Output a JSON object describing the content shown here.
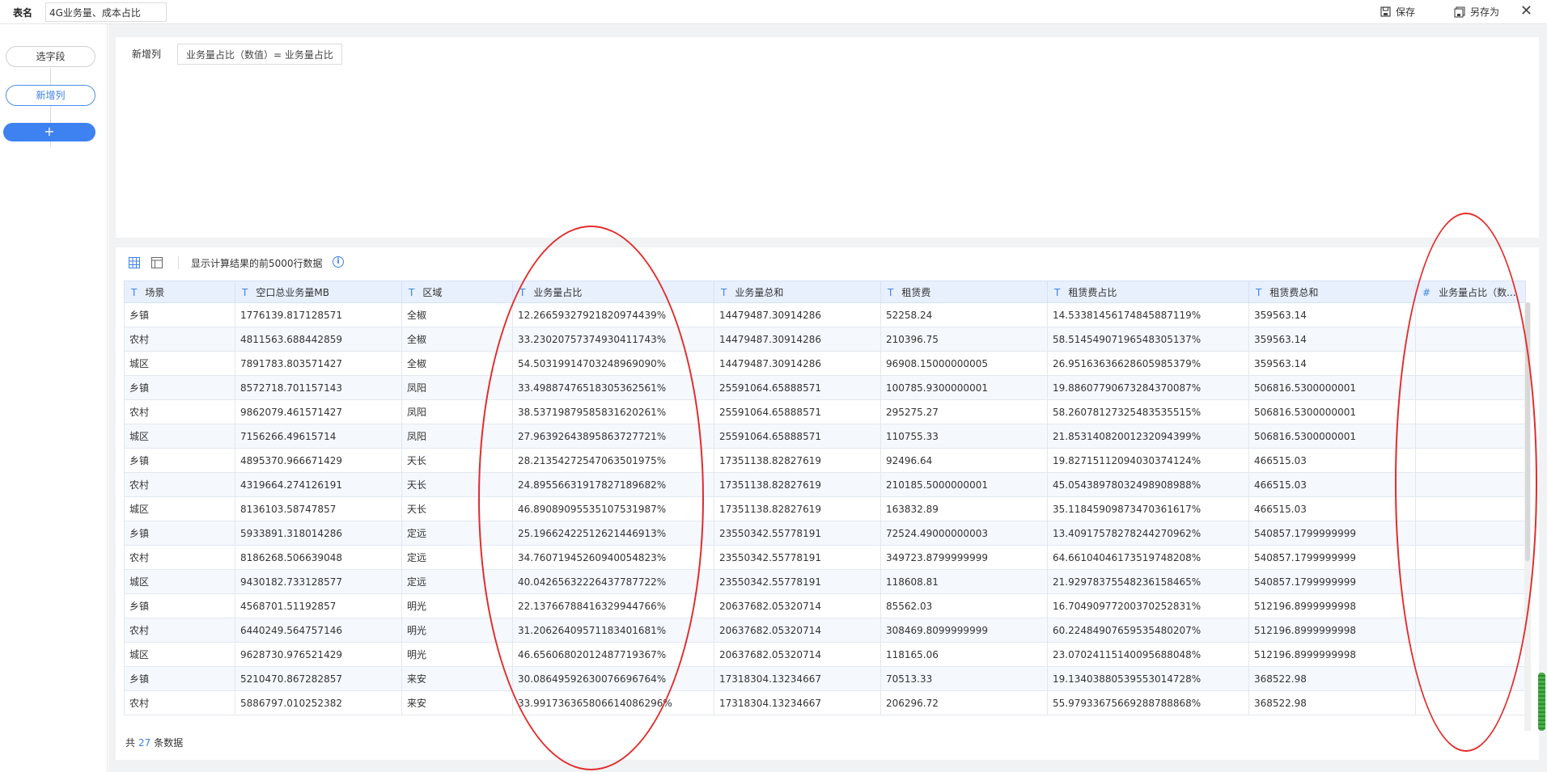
{
  "topbar": {
    "table_name_label": "表名",
    "table_name_value": "4G业务量、成本占比",
    "save_label": "保存",
    "save_as_label": "另存为"
  },
  "sidebar": {
    "items": [
      {
        "label": "选字段"
      },
      {
        "label": "新增列"
      }
    ],
    "add_label": "+"
  },
  "formula": {
    "label": "新增列",
    "chip": "业务量占比（数值）= 业务量占比"
  },
  "table_toolbar": {
    "info_text": "显示计算结果的前5000行数据",
    "info_icon": "i"
  },
  "table": {
    "columns": [
      {
        "type": "T",
        "name": "场景"
      },
      {
        "type": "T",
        "name": "空口总业务量MB"
      },
      {
        "type": "T",
        "name": "区域"
      },
      {
        "type": "T",
        "name": "业务量占比"
      },
      {
        "type": "T",
        "name": "业务量总和"
      },
      {
        "type": "T",
        "name": "租赁费"
      },
      {
        "type": "T",
        "name": "租赁费占比"
      },
      {
        "type": "T",
        "name": "租赁费总和"
      },
      {
        "type": "#",
        "name": "业务量占比（数..."
      }
    ],
    "rows": [
      [
        "乡镇",
        "1776139.817128571",
        "全椒",
        "12.2665932792182097443​9%",
        "14479487.30914286",
        "52258.24",
        "14.53381456174845887119%",
        "359563.14",
        ""
      ],
      [
        "农村",
        "4811563.688442859",
        "全椒",
        "33.23020757374930411743%",
        "14479487.30914286",
        "210396.75",
        "58.51454907196548305137%",
        "359563.14",
        ""
      ],
      [
        "城区",
        "7891783.803571427",
        "全椒",
        "54.50319914703248969090%",
        "14479487.30914286",
        "96908.15000000005",
        "26.95163636628605985379%",
        "359563.14",
        ""
      ],
      [
        "乡镇",
        "8572718.701157143",
        "凤阳",
        "33.49887476518305362561%",
        "25591064.65888571",
        "100785.9300000001",
        "19.88607790673284370087%",
        "506816.5300000001",
        ""
      ],
      [
        "农村",
        "9862079.461571427",
        "凤阳",
        "38.53719879585831620261%",
        "25591064.65888571",
        "295275.27",
        "58.26078127325483535515%",
        "506816.5300000001",
        ""
      ],
      [
        "城区",
        "7156266.49615714",
        "凤阳",
        "27.96392643895863727721%",
        "25591064.65888571",
        "110755.33",
        "21.85314082001232094399%",
        "506816.5300000001",
        ""
      ],
      [
        "乡镇",
        "4895370.966671429",
        "天长",
        "28.21354272547063501975%",
        "17351138.82827619",
        "92496.64",
        "19.82715112094030374124%",
        "466515.03",
        ""
      ],
      [
        "农村",
        "4319664.274126191",
        "天长",
        "24.89556631917827189682%",
        "17351138.82827619",
        "210185.5000000001",
        "45.05438978032498908988%",
        "466515.03",
        ""
      ],
      [
        "城区",
        "8136103.58747857",
        "天长",
        "46.89089095535107531987%",
        "17351138.82827619",
        "163832.89",
        "35.11845909873470361617%",
        "466515.03",
        ""
      ],
      [
        "乡镇",
        "5933891.318014286",
        "定远",
        "25.19662422512621446913%",
        "23550342.55778191",
        "72524.49000000003",
        "13.40917578278244270962%",
        "540857.1799999999",
        ""
      ],
      [
        "农村",
        "8186268.506639048",
        "定远",
        "34.76071945260940054823%",
        "23550342.55778191",
        "349723.8799999999",
        "64.66104046173519748208%",
        "540857.1799999999",
        ""
      ],
      [
        "城区",
        "9430182.733128577",
        "定远",
        "40.04265632226437787722%",
        "23550342.55778191",
        "118608.81",
        "21.92978375548236158465%",
        "540857.1799999999",
        ""
      ],
      [
        "乡镇",
        "4568701.51192857",
        "明光",
        "22.13766788416329944766%",
        "20637682.05320714",
        "85562.03",
        "16.70490977200370252831%",
        "512196.8999999998",
        ""
      ],
      [
        "农村",
        "6440249.564757146",
        "明光",
        "31.20626409571183401681%",
        "20637682.05320714",
        "308469.8099999999",
        "60.22484907659535480207%",
        "512196.8999999998",
        ""
      ],
      [
        "城区",
        "9628730.976521429",
        "明光",
        "46.65606802012487719367%",
        "20637682.05320714",
        "118165.06",
        "23.07024115140095688048%",
        "512196.8999999998",
        ""
      ],
      [
        "乡镇",
        "5210470.867282857",
        "来安",
        "30.08649592630076696764%",
        "17318304.13234667",
        "70513.33",
        "19.13403880539553014728%",
        "368522.98",
        ""
      ],
      [
        "农村",
        "5886797.010252382",
        "来安",
        "33.99173636580661408629​6%",
        "17318304.13234667",
        "206296.72",
        "55.97933675669288788868%",
        "368522.98",
        ""
      ]
    ]
  },
  "footer": {
    "prefix": "共",
    "count": "27",
    "suffix": "条数据"
  },
  "colors": {
    "accent": "#3d82f0",
    "header_bg": "#e8f0fd",
    "annotation_red": "#e32b2b"
  }
}
